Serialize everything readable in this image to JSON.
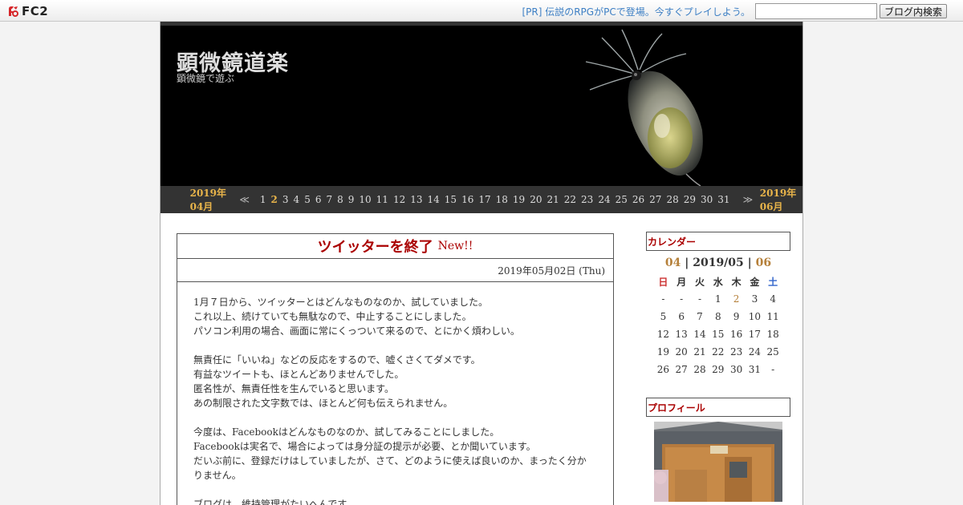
{
  "fc2": {
    "logo_text": "FC2",
    "pr_text": "[PR] 伝説のRPGがPCで登場。今すぐプレイしよう。",
    "search_value": "",
    "search_button": "ブログ内検索"
  },
  "header": {
    "title": "顕微鏡道楽",
    "description": "顕微鏡で遊ぶ"
  },
  "datenav": {
    "prev_month": "2019年04月",
    "prev_arrow": "≪",
    "days": [
      "1",
      "2",
      "3",
      "4",
      "5",
      "6",
      "7",
      "8",
      "9",
      "10",
      "11",
      "12",
      "13",
      "14",
      "15",
      "16",
      "17",
      "18",
      "19",
      "20",
      "21",
      "22",
      "23",
      "24",
      "25",
      "26",
      "27",
      "28",
      "29",
      "30",
      "31"
    ],
    "active_day": "2",
    "next_arrow": "≫",
    "next_month": "2019年06月"
  },
  "entry": {
    "title": "ツイッターを終了",
    "new_badge": "New!!",
    "date": "2019年05月02日 (Thu)",
    "paragraphs": [
      [
        "1月７日から、ツイッターとはどんなものなのか、試していました。",
        "これ以上、続けていても無駄なので、中止することにしました。",
        "パソコン利用の場合、画面に常にくっついて来るので、とにかく煩わしい。"
      ],
      [
        "無責任に「いいね」などの反応をするので、嘘くさくてダメです。",
        "有益なツイートも、ほとんどありませんでした。",
        "匿名性が、無責任性を生んでいると思います。",
        "あの制限された文字数では、ほとんど何も伝えられません。"
      ],
      [
        "今度は、Facebookはどんなものなのか、試してみることにしました。",
        "Facebookは実名で、場合によっては身分証の提示が必要、とか聞いています。",
        "だいぶ前に、登録だけはしていましたが、さて、どのように使えば良いのか、まったく分か",
        "りません。"
      ],
      [
        "ブログは、維持管理がたいへんです。"
      ]
    ]
  },
  "sidebar": {
    "calendar_title": "カレンダー",
    "cal_prev": "04",
    "cal_current": "2019/05",
    "cal_next": "06",
    "weekdays": [
      "日",
      "月",
      "火",
      "水",
      "木",
      "金",
      "土"
    ],
    "weeks": [
      [
        "-",
        "-",
        "-",
        "1",
        "2",
        "3",
        "4"
      ],
      [
        "5",
        "6",
        "7",
        "8",
        "9",
        "10",
        "11"
      ],
      [
        "12",
        "13",
        "14",
        "15",
        "16",
        "17",
        "18"
      ],
      [
        "19",
        "20",
        "21",
        "22",
        "23",
        "24",
        "25"
      ],
      [
        "26",
        "27",
        "28",
        "29",
        "30",
        "31",
        "-"
      ]
    ],
    "highlight_day": "2",
    "profile_title": "プロフィール"
  },
  "colors": {
    "accent": "#e8b44a",
    "title_red": "#aa0000",
    "pr_link": "#3d7fc4",
    "nav_bg": "#333333"
  }
}
